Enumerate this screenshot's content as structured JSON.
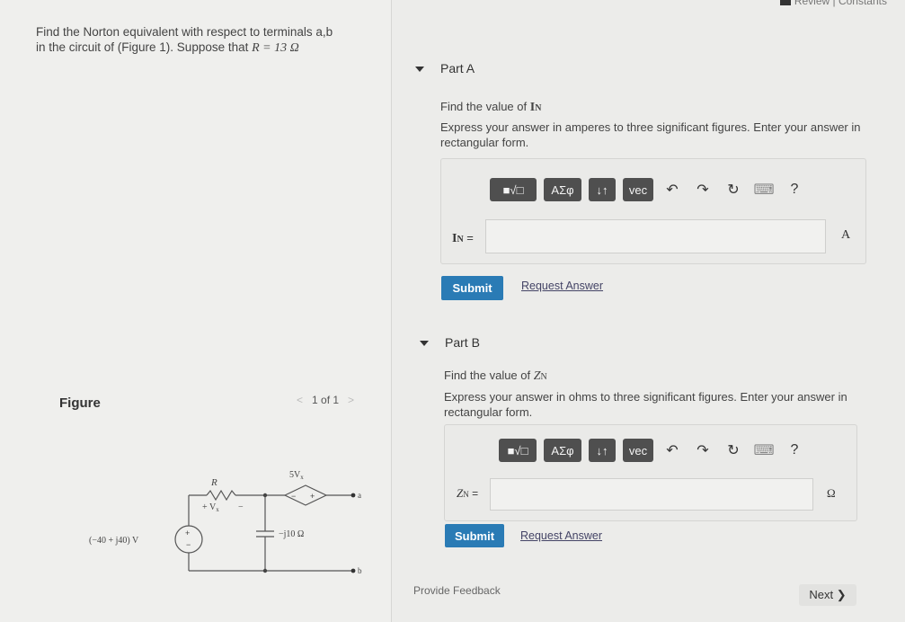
{
  "header": {
    "review_label": "Review | Constants"
  },
  "problem": {
    "line1": "Find the Norton equivalent with respect to terminals a,b",
    "line2_prefix": "in the circuit of (Figure 1). Suppose that ",
    "line2_math": "R = 13  Ω"
  },
  "figure": {
    "label": "Figure",
    "pager": "1 of 1",
    "prev": "<",
    "next": ">"
  },
  "circuit": {
    "resistor": "R",
    "source_dep": "5V",
    "source_dep_sub": "x",
    "vx_label": "+  V",
    "vx_sub": "x",
    "vx_minus": "−",
    "source": "(−40 + j40) V",
    "cap": "−j10 Ω",
    "term_a": "a",
    "term_b": "b",
    "plus": "+",
    "minus": "−"
  },
  "partA": {
    "title": "Part A",
    "find": "Find the value of ",
    "find_var": "I",
    "find_sub": "N",
    "instr": "Express your answer in amperes to three significant figures. Enter your answer in rectangular form.",
    "var": "I",
    "var_sub": "N",
    "eq": " =",
    "unit": "A",
    "input_value": "",
    "submit": "Submit",
    "request": "Request Answer"
  },
  "partB": {
    "title": "Part B",
    "find": "Find the value of ",
    "find_var": "Z",
    "find_sub": "N",
    "instr": "Express your answer in ohms to three significant figures. Enter your answer in rectangular form.",
    "var": "Z",
    "var_sub": "N",
    "eq": " =",
    "unit": "Ω",
    "input_value": "",
    "submit": "Submit",
    "request": "Request Answer"
  },
  "toolbar": {
    "templates": "■√□",
    "greek": "ΑΣφ",
    "arrows": "↓↑",
    "vec": "vec",
    "undo": "↶",
    "redo": "↷",
    "reset": "↻",
    "keyboard": "⌨",
    "help": "?"
  },
  "footer": {
    "feedback": "Provide Feedback",
    "next": "Next ❯"
  }
}
